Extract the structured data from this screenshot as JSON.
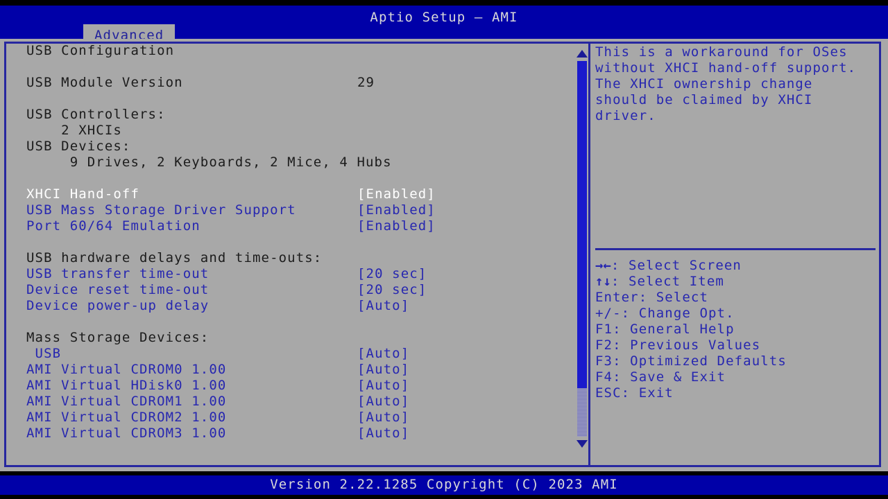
{
  "header": {
    "title": "Aptio Setup – AMI",
    "tabs": [
      {
        "label": "Advanced",
        "active": true
      }
    ]
  },
  "colors": {
    "header_bg": "#0000a8",
    "panel_bg": "#a8a8a8",
    "border": "#2727a0",
    "option_text": "#2727b0",
    "info_text": "#1c1c1c",
    "selected_text": "#ffffff",
    "scrollbar_thumb": "#1a1acc",
    "footer_bg": "#0000a8"
  },
  "main": {
    "page_title": "USB Configuration",
    "rows": [
      {
        "type": "heading",
        "label": "USB Configuration",
        "value": "",
        "style": "info",
        "interactable": false
      },
      {
        "type": "spacer"
      },
      {
        "type": "info",
        "label": "USB Module Version",
        "value": "29",
        "style": "info",
        "interactable": false
      },
      {
        "type": "spacer"
      },
      {
        "type": "info",
        "label": "USB Controllers:",
        "value": "",
        "style": "info",
        "interactable": false
      },
      {
        "type": "info",
        "label": "    2 XHCIs",
        "value": "",
        "style": "info",
        "interactable": false
      },
      {
        "type": "info",
        "label": "USB Devices:",
        "value": "",
        "style": "info",
        "interactable": false
      },
      {
        "type": "info",
        "label": "     9 Drives, 2 Keyboards, 2 Mice, 4 Hubs",
        "value": "",
        "style": "info",
        "interactable": false
      },
      {
        "type": "spacer"
      },
      {
        "type": "option",
        "label": "XHCI Hand-off",
        "value": "[Enabled]",
        "style": "selected",
        "interactable": true
      },
      {
        "type": "option",
        "label": "USB Mass Storage Driver Support",
        "value": "[Enabled]",
        "style": "option",
        "interactable": true
      },
      {
        "type": "option",
        "label": "Port 60/64 Emulation",
        "value": "[Enabled]",
        "style": "option",
        "interactable": true
      },
      {
        "type": "spacer"
      },
      {
        "type": "info",
        "label": "USB hardware delays and time-outs:",
        "value": "",
        "style": "info",
        "interactable": false
      },
      {
        "type": "option",
        "label": "USB transfer time-out",
        "value": "[20 sec]",
        "style": "option",
        "interactable": true
      },
      {
        "type": "option",
        "label": "Device reset time-out",
        "value": "[20 sec]",
        "style": "option",
        "interactable": true
      },
      {
        "type": "option",
        "label": "Device power-up delay",
        "value": "[Auto]",
        "style": "option",
        "interactable": true
      },
      {
        "type": "spacer"
      },
      {
        "type": "info",
        "label": "Mass Storage Devices:",
        "value": "",
        "style": "info",
        "interactable": false
      },
      {
        "type": "option",
        "label": " USB",
        "value": "[Auto]",
        "style": "option",
        "interactable": true
      },
      {
        "type": "option",
        "label": "AMI Virtual CDROM0 1.00",
        "value": "[Auto]",
        "style": "option",
        "interactable": true
      },
      {
        "type": "option",
        "label": "AMI Virtual HDisk0 1.00",
        "value": "[Auto]",
        "style": "option",
        "interactable": true
      },
      {
        "type": "option",
        "label": "AMI Virtual CDROM1 1.00",
        "value": "[Auto]",
        "style": "option",
        "interactable": true
      },
      {
        "type": "option",
        "label": "AMI Virtual CDROM2 1.00",
        "value": "[Auto]",
        "style": "option",
        "interactable": true
      },
      {
        "type": "option",
        "label": "AMI Virtual CDROM3 1.00",
        "value": "[Auto]",
        "style": "option",
        "interactable": true
      }
    ]
  },
  "scrollbar": {
    "up_arrow": "scroll-up-arrow",
    "down_arrow": "scroll-down-arrow"
  },
  "help": {
    "lines": [
      "This is a workaround for OSes",
      "without XHCI hand-off support.",
      "The XHCI ownership change",
      "should be claimed by XHCI",
      "driver."
    ]
  },
  "keys": [
    {
      "glyph": "→←",
      "text": ": Select Screen"
    },
    {
      "glyph": "↑↓",
      "text": ": Select Item"
    },
    {
      "glyph": "",
      "text": "Enter: Select"
    },
    {
      "glyph": "",
      "text": "+/-: Change Opt."
    },
    {
      "glyph": "",
      "text": "F1: General Help"
    },
    {
      "glyph": "",
      "text": "F2: Previous Values"
    },
    {
      "glyph": "",
      "text": "F3: Optimized Defaults"
    },
    {
      "glyph": "",
      "text": "F4: Save & Exit"
    },
    {
      "glyph": "",
      "text": "ESC: Exit"
    }
  ],
  "footer": {
    "text": "Version 2.22.1285 Copyright (C) 2023 AMI"
  }
}
